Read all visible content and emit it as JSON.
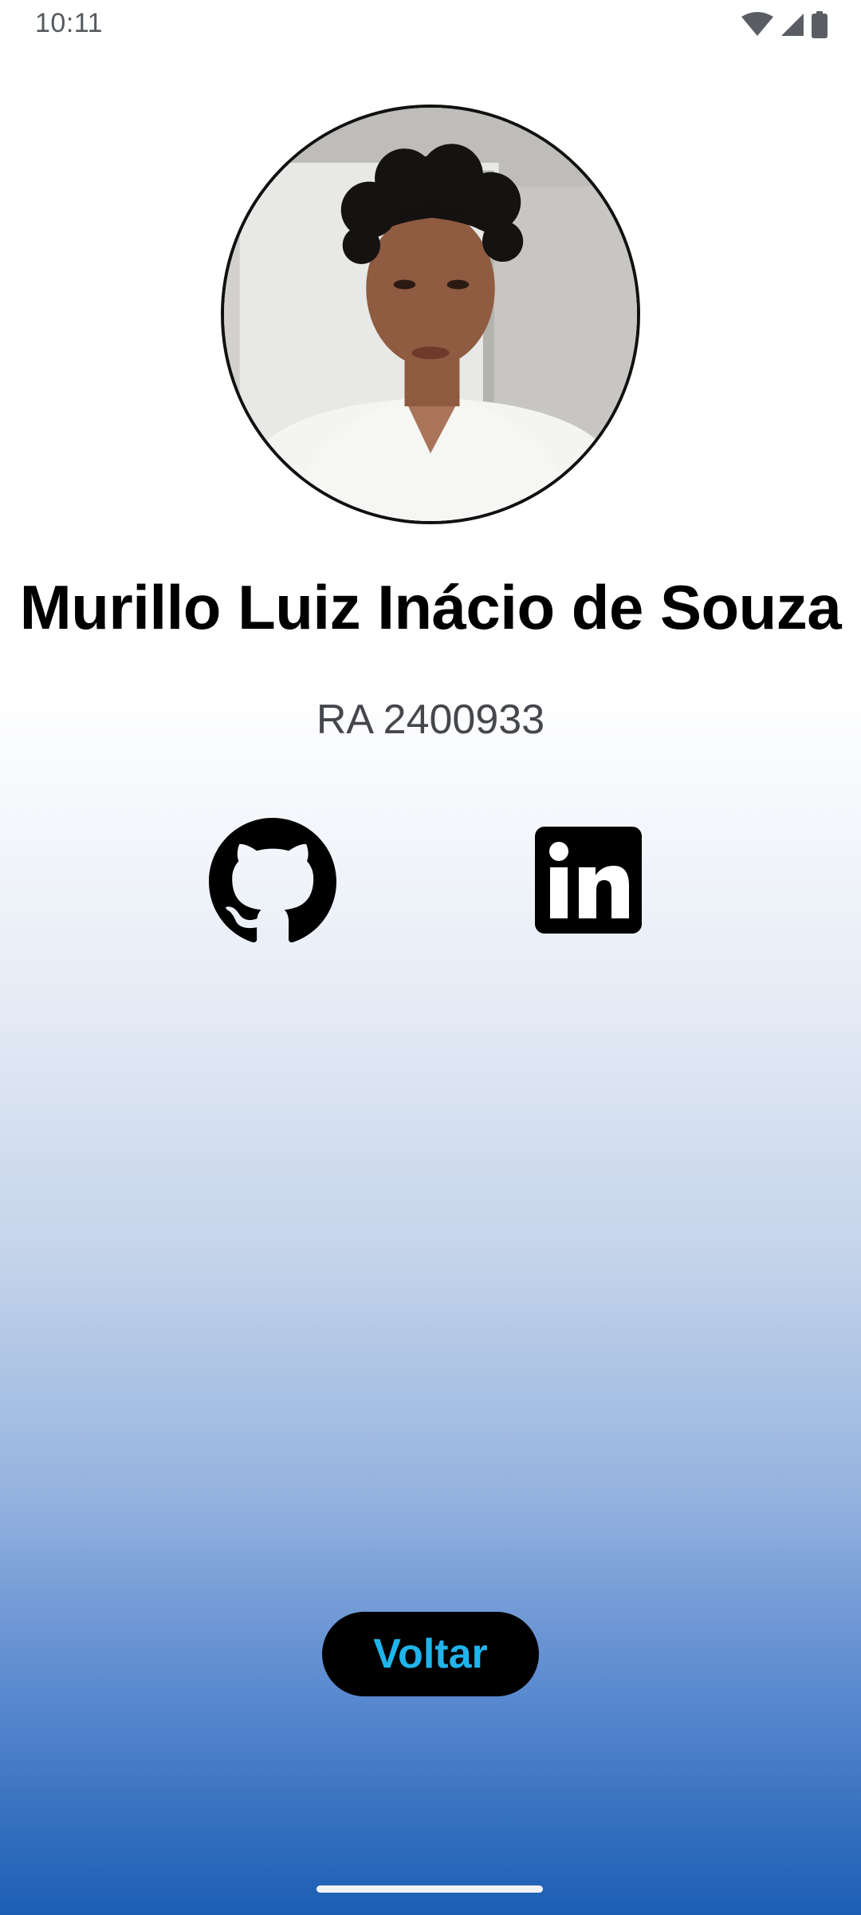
{
  "status_bar": {
    "time": "10:11",
    "icons": [
      "wifi-icon",
      "cellular-signal-icon",
      "battery-icon"
    ]
  },
  "profile": {
    "photo": "profile-photo",
    "name": "Murillo Luiz Inácio de Souza",
    "ra": "RA 2400933"
  },
  "social": {
    "github_icon": "github-icon",
    "linkedin_icon": "linkedin-icon"
  },
  "actions": {
    "back_label": "Voltar"
  },
  "colors": {
    "gradient_top": "#ffffff",
    "gradient_bottom": "#1b5eb4",
    "button_bg": "#000000",
    "button_text": "#1fb4ec",
    "ra_text": "#45474d"
  }
}
